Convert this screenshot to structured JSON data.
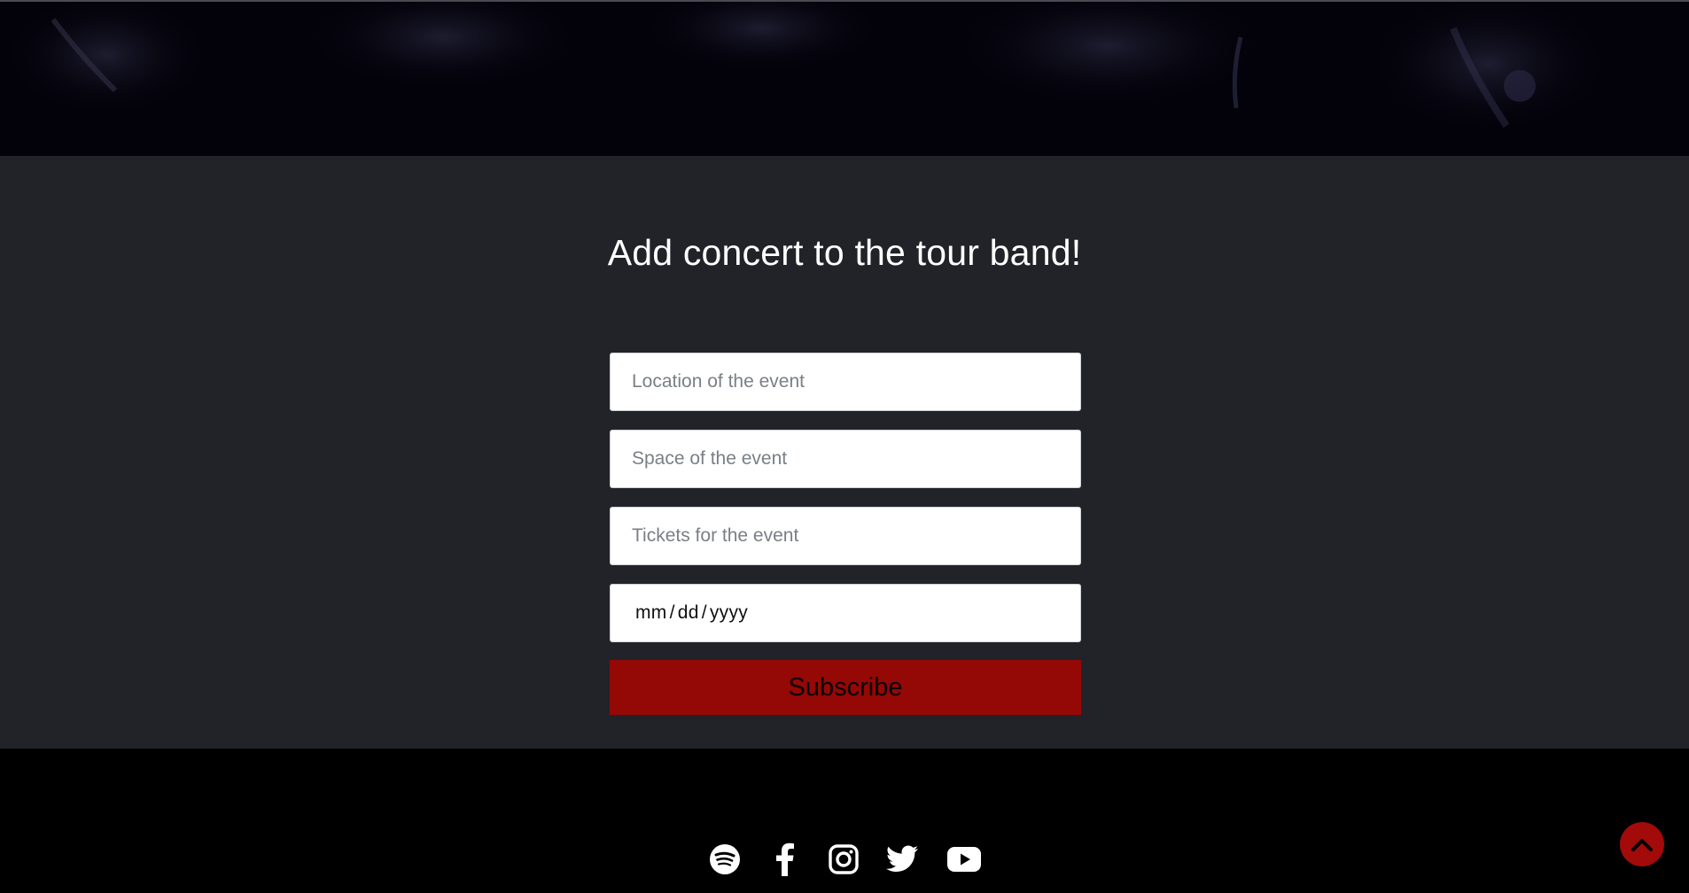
{
  "form": {
    "title": "Add concert to the tour band!",
    "location_placeholder": "Location of the event",
    "space_placeholder": "Space of the event",
    "tickets_placeholder": "Tickets for the event",
    "date_mm": "mm",
    "date_dd": "dd",
    "date_yyyy": "yyyy",
    "date_sep": "/",
    "submit_label": "Subscribe"
  },
  "footer": {
    "social_icons": [
      "spotify-icon",
      "facebook-icon",
      "instagram-icon",
      "twitter-icon",
      "youtube-icon"
    ]
  },
  "colors": {
    "accent": "#940806",
    "section_bg": "#212328",
    "footer_bg": "#000000"
  }
}
